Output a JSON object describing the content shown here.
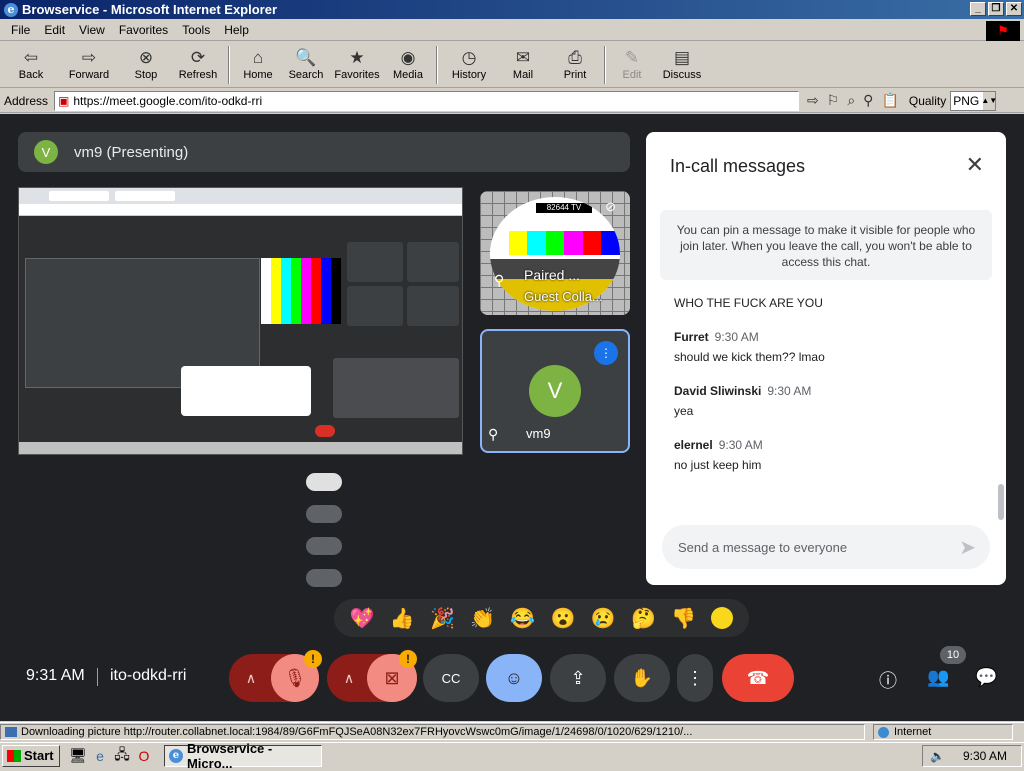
{
  "window": {
    "title": "Browservice - Microsoft Internet Explorer"
  },
  "menu": [
    "File",
    "Edit",
    "View",
    "Favorites",
    "Tools",
    "Help"
  ],
  "toolbar": [
    {
      "label": "Back",
      "icon": "back-arrow-icon",
      "glyph": "⇦"
    },
    {
      "label": "Forward",
      "icon": "forward-arrow-icon",
      "glyph": "⇨"
    },
    {
      "label": "Stop",
      "icon": "stop-icon",
      "glyph": "⊗"
    },
    {
      "label": "Refresh",
      "icon": "refresh-icon",
      "glyph": "⟳"
    },
    {
      "label": "Home",
      "icon": "home-icon",
      "glyph": "⌂"
    },
    {
      "label": "Search",
      "icon": "search-icon",
      "glyph": "🔍"
    },
    {
      "label": "Favorites",
      "icon": "favorites-icon",
      "glyph": "★"
    },
    {
      "label": "Media",
      "icon": "media-icon",
      "glyph": "◉"
    },
    {
      "label": "History",
      "icon": "history-icon",
      "glyph": "◷"
    },
    {
      "label": "Mail",
      "icon": "mail-icon",
      "glyph": "✉"
    },
    {
      "label": "Print",
      "icon": "print-icon",
      "glyph": "⎙"
    },
    {
      "label": "Edit",
      "icon": "edit-icon",
      "glyph": "✎"
    },
    {
      "label": "Discuss",
      "icon": "discuss-icon",
      "glyph": "▤"
    }
  ],
  "address": {
    "label": "Address",
    "url": "https://meet.google.com/ito-odkd-rri",
    "quality_label": "Quality",
    "quality_value": "PNG"
  },
  "meet": {
    "presenting_avatar": "V",
    "presenting_title": "vm9 (Presenting)",
    "tv_header": "82644 TV",
    "tv_tile_label": "Paired ...",
    "tv_tile_label2": "Guest Colla...",
    "vm_avatar": "V",
    "vm_name": "vm9",
    "time": "9:31 AM",
    "meeting_code": "ito-odkd-rri",
    "people_count": "10"
  },
  "chat": {
    "title": "In-call messages",
    "pin_note": "You can pin a message to make it visible for people who join later. When you leave the call, you won't be able to access this chat.",
    "messages": [
      {
        "sender": "",
        "time": "",
        "text": "WHO THE FUCK ARE YOU"
      },
      {
        "sender": "Furret",
        "time": "9:30 AM",
        "text": "should we kick them?? lmao"
      },
      {
        "sender": "David Sliwinski",
        "time": "9:30 AM",
        "text": "yea"
      },
      {
        "sender": "elernel",
        "time": "9:30 AM",
        "text": "no just keep him"
      }
    ],
    "input_placeholder": "Send a message to everyone"
  },
  "reactions": [
    "💖",
    "👍",
    "🎉",
    "👏",
    "😂",
    "😮",
    "😢",
    "🤔",
    "👎"
  ],
  "status": {
    "text": "Downloading picture http://router.collabnet.local:1984/89/G6FmFQJSeA08N32ex7FRHyovcWswc0mG/image/1/24698/0/1020/629/1210/...",
    "zone": "Internet"
  },
  "taskbar": {
    "start": "Start",
    "task": "Browservice - Micro...",
    "clock": "9:30 AM"
  },
  "colors": {
    "meet_bg": "#202124",
    "panel": "#3c4043",
    "accent": "#8ab4f8",
    "end_call": "#ea4335",
    "muted": "#8c1d18"
  }
}
